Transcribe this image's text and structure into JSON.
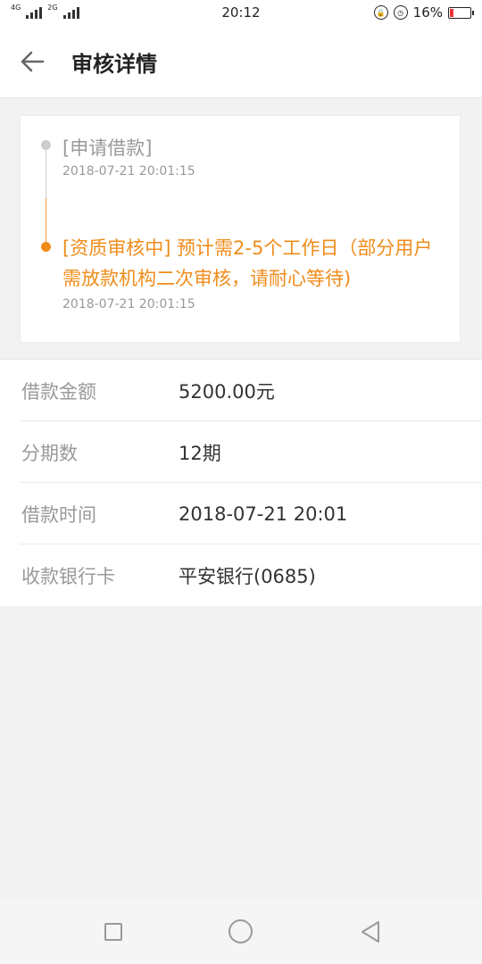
{
  "status_bar": {
    "net1": "4G",
    "net2": "2G",
    "time": "20:12",
    "battery": "16%"
  },
  "header": {
    "title": "审核详情"
  },
  "timeline": [
    {
      "title": "[申请借款]",
      "time": "2018-07-21 20:01:15",
      "status": "done",
      "color": "#999999"
    },
    {
      "title": "[资质审核中] 预计需2-5个工作日（部分用户需放款机构二次审核，请耐心等待)",
      "time": "2018-07-21 20:01:15",
      "status": "current",
      "color": "#f08c1a"
    }
  ],
  "details": [
    {
      "label": "借款金额",
      "value": "5200.00元"
    },
    {
      "label": "分期数",
      "value": "12期"
    },
    {
      "label": "借款时间",
      "value": "2018-07-21 20:01"
    },
    {
      "label": "收款银行卡",
      "value": "平安银行(0685)"
    }
  ],
  "icons": {
    "back": "arrow-left-icon",
    "nav_recent": "square-icon",
    "nav_home": "circle-icon",
    "nav_back": "triangle-back-icon"
  }
}
